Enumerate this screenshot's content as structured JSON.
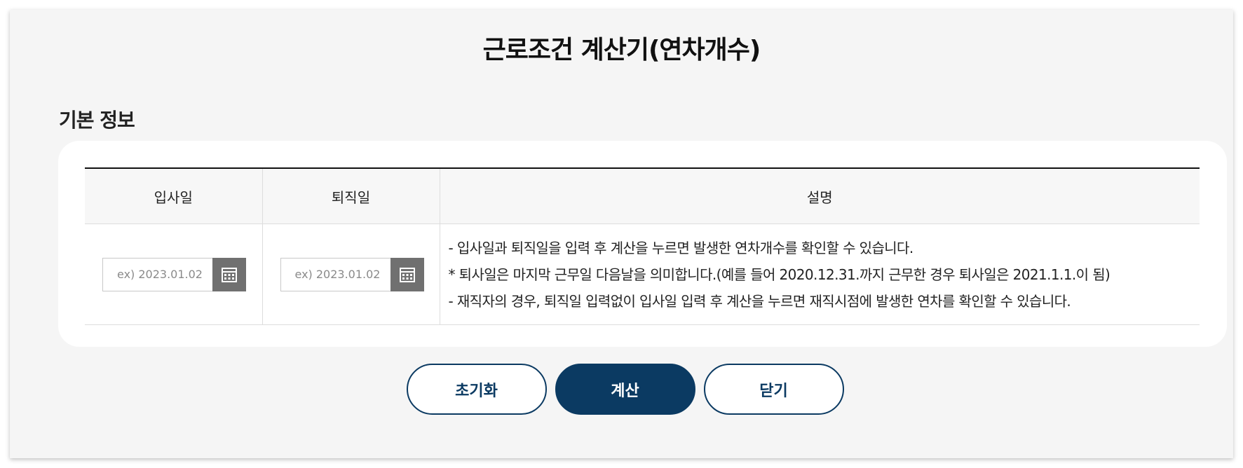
{
  "page": {
    "title": "근로조건 계산기(연차개수)",
    "section_title": "기본 정보"
  },
  "table": {
    "headers": [
      "입사일",
      "퇴직일",
      "설명"
    ],
    "hire_date": {
      "value": "",
      "placeholder": "ex) 2023.01.02"
    },
    "leave_date": {
      "value": "",
      "placeholder": "ex) 2023.01.02"
    },
    "description": [
      "- 입사일과 퇴직일을 입력 후 계산을 누르면 발생한 연차개수를 확인할 수 있습니다.",
      "* 퇴사일은 마지막 근무일 다음날을 의미합니다.(예를 들어 2020.12.31.까지 근무한 경우 퇴사일은 2021.1.1.이 됨)",
      "- 재직자의 경우, 퇴직일 입력없이 입사일 입력 후 계산을 누르면 재직시점에 발생한 연차를 확인할 수 있습니다."
    ]
  },
  "buttons": {
    "reset": "초기화",
    "calculate": "계산",
    "close": "닫기"
  },
  "colors": {
    "primary": "#0b3a62",
    "calendar_button": "#707070",
    "panel_bg": "#f5f5f5"
  }
}
